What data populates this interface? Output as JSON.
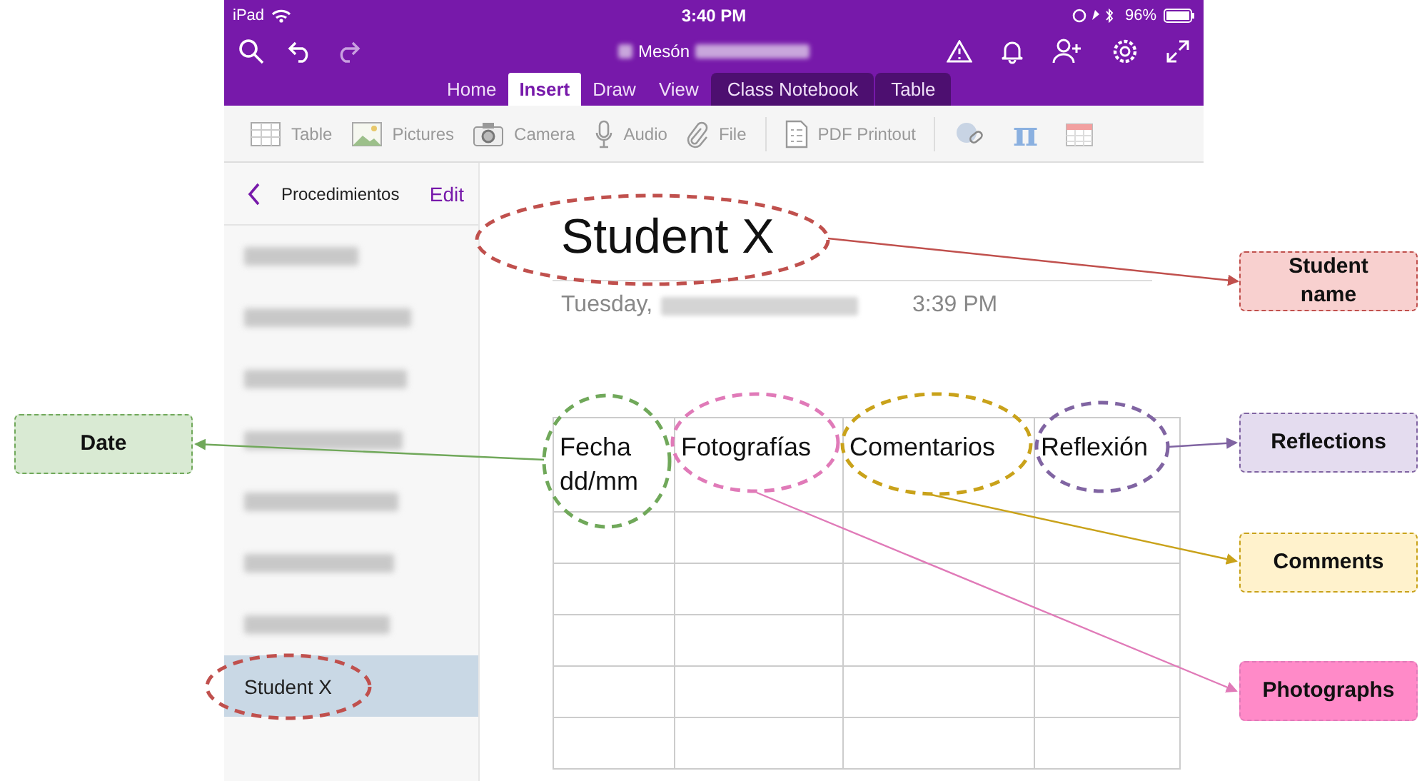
{
  "status_bar": {
    "device": "iPad",
    "time": "3:40 PM",
    "battery": "96%"
  },
  "title_bar": {
    "notebook": "Mesón"
  },
  "tabs": [
    {
      "label": "Home",
      "selected": false,
      "kind": "main"
    },
    {
      "label": "Insert",
      "selected": true,
      "kind": "main"
    },
    {
      "label": "Draw",
      "selected": false,
      "kind": "main"
    },
    {
      "label": "View",
      "selected": false,
      "kind": "main"
    },
    {
      "label": "Class Notebook",
      "selected": false,
      "kind": "contextual"
    },
    {
      "label": "Table",
      "selected": false,
      "kind": "contextual"
    }
  ],
  "toolbar": [
    {
      "label": "Table"
    },
    {
      "label": "Pictures"
    },
    {
      "label": "Camera"
    },
    {
      "label": "Audio"
    },
    {
      "label": "File"
    },
    {
      "label": "PDF Printout"
    },
    {
      "label": "π"
    }
  ],
  "sidebar": {
    "section": "Procedimientos",
    "edit": "Edit",
    "pages": [
      {
        "kind": "blurred",
        "selected": false
      },
      {
        "kind": "blurred",
        "selected": false
      },
      {
        "kind": "blurred",
        "selected": false
      },
      {
        "kind": "blurred",
        "selected": false
      },
      {
        "kind": "blurred",
        "selected": false
      },
      {
        "kind": "blurred",
        "selected": false
      },
      {
        "kind": "blurred",
        "selected": false
      },
      {
        "kind": "page",
        "title": "Student X",
        "selected": true
      }
    ]
  },
  "page": {
    "title": "Student X",
    "date": "Tuesday,",
    "time": "3:39 PM",
    "table": {
      "columns": [
        "Fecha dd/mm",
        "Fotografías",
        "Comentarios",
        "Reflexión"
      ]
    }
  },
  "callouts": [
    {
      "label": "Student name",
      "color": "#c0504d"
    },
    {
      "label": "Date",
      "color": "#70a85a"
    },
    {
      "label": "Reflections",
      "color": "#8064a2"
    },
    {
      "label": "Comments",
      "color": "#c9a21a"
    },
    {
      "label": "Photographs",
      "color": "#e07ab8"
    }
  ]
}
